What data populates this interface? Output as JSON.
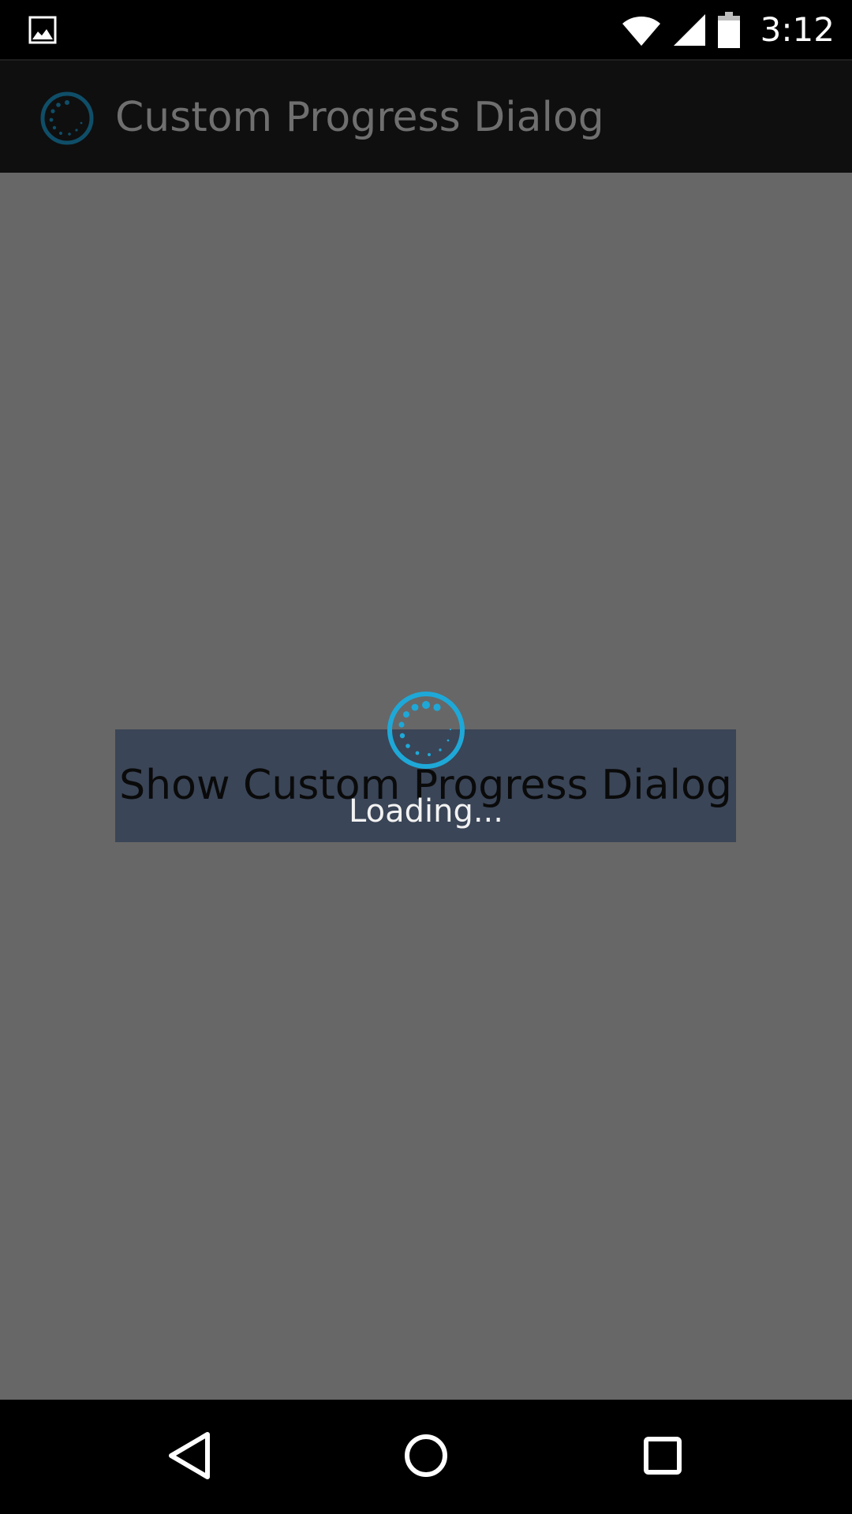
{
  "status_bar": {
    "notification_icon": "image-icon",
    "wifi_icon": "wifi-icon",
    "signal_icon": "cell-signal-icon",
    "battery_icon": "battery-icon",
    "time": "3:12"
  },
  "app_bar": {
    "icon": "spinner-logo-icon",
    "title": "Custom Progress Dialog"
  },
  "main": {
    "button_label": "Show Custom Progress Dialog"
  },
  "progress_dialog": {
    "spinner_icon": "progress-spinner-icon",
    "message": "Loading..."
  },
  "nav_bar": {
    "back_icon": "back-triangle-icon",
    "home_icon": "home-circle-icon",
    "recents_icon": "recents-square-icon"
  },
  "colors": {
    "accent": "#1ea8d8",
    "dim_overlay": "#676767",
    "button_bg": "#3a4557",
    "app_bar_bg": "#0f0f0f"
  }
}
